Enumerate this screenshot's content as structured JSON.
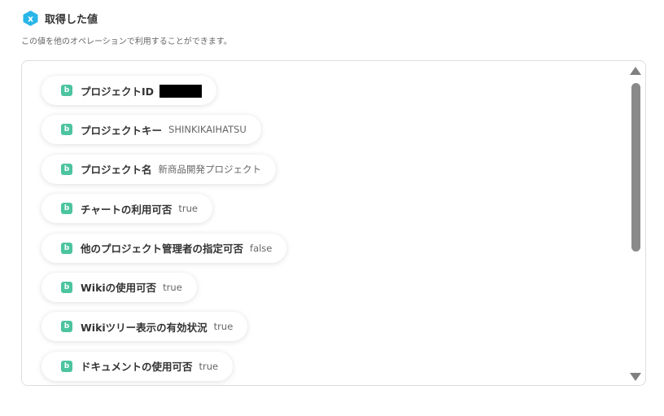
{
  "header": {
    "title": "取得した値",
    "icon": "x-hexagon-icon",
    "icon_letter": "x",
    "icon_color": "#29b5e8"
  },
  "subtitle": "この値を他のオペレーションで利用することができます。",
  "badge": {
    "letter": "b",
    "color": "#4cc49f"
  },
  "items": [
    {
      "label": "プロジェクトID",
      "value": "",
      "redacted": true
    },
    {
      "label": "プロジェクトキー",
      "value": "SHINKIKAIHATSU"
    },
    {
      "label": "プロジェクト名",
      "value": "新商品開発プロジェクト"
    },
    {
      "label": "チャートの利用可否",
      "value": "true"
    },
    {
      "label": "他のプロジェクト管理者の指定可否",
      "value": "false"
    },
    {
      "label": "Wikiの使用可否",
      "value": "true"
    },
    {
      "label": "Wikiツリー表示の有効状況",
      "value": "true"
    },
    {
      "label": "ドキュメントの使用可否",
      "value": "true"
    }
  ]
}
